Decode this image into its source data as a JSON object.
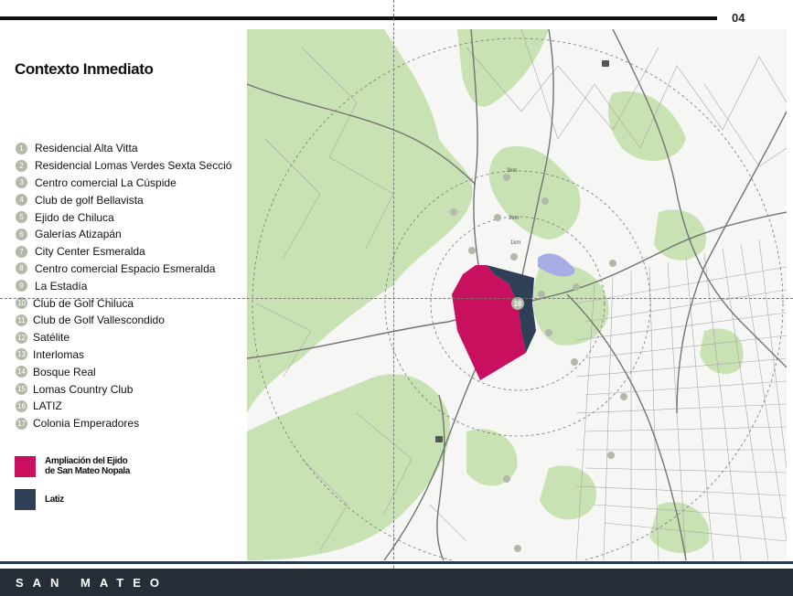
{
  "page": {
    "number": "04",
    "title": "Contexto Inmediato"
  },
  "points_of_interest": [
    {
      "num": "1",
      "label": "Residencial Alta Vitta"
    },
    {
      "num": "2",
      "label": "Residencial Lomas Verdes Sexta Secció"
    },
    {
      "num": "3",
      "label": "Centro comercial La Cúspide"
    },
    {
      "num": "4",
      "label": "Club de golf Bellavista"
    },
    {
      "num": "5",
      "label": "Ejido de Chiluca"
    },
    {
      "num": "6",
      "label": "Galerías Atizapán"
    },
    {
      "num": "7",
      "label": "City Center Esmeralda"
    },
    {
      "num": "8",
      "label": "Centro comercial Espacio Esmeralda"
    },
    {
      "num": "9",
      "label": "La Estadía"
    },
    {
      "num": "10",
      "label": "Club de Golf Chiluca"
    },
    {
      "num": "11",
      "label": "Club de Golf Vallescondido"
    },
    {
      "num": "12",
      "label": "Satélite"
    },
    {
      "num": "13",
      "label": "Interlomas"
    },
    {
      "num": "14",
      "label": "Bosque Real"
    },
    {
      "num": "15",
      "label": "Lomas Country Club"
    },
    {
      "num": "16",
      "label": "LATIZ"
    },
    {
      "num": "17",
      "label": "Colonia Emperadores"
    }
  ],
  "legend": [
    {
      "line1": "Ampliación del Ejido",
      "line2": "de San Mateo Nopala",
      "color": "#c8105f"
    },
    {
      "line1": "Latiz",
      "line2": "",
      "color": "#2f3f58"
    }
  ],
  "map": {
    "site_marker": "16",
    "ring_labels": [
      "3km",
      "2km",
      "1km"
    ],
    "parcel_colors": {
      "ampliacion": "#c8105f",
      "latiz": "#2f3f58"
    },
    "poi_marker_color": "#b2b9a8",
    "green_color": "#c9e2b3",
    "water_color": "#a7aee6"
  },
  "footer": {
    "brand": "SAN MATEO"
  }
}
